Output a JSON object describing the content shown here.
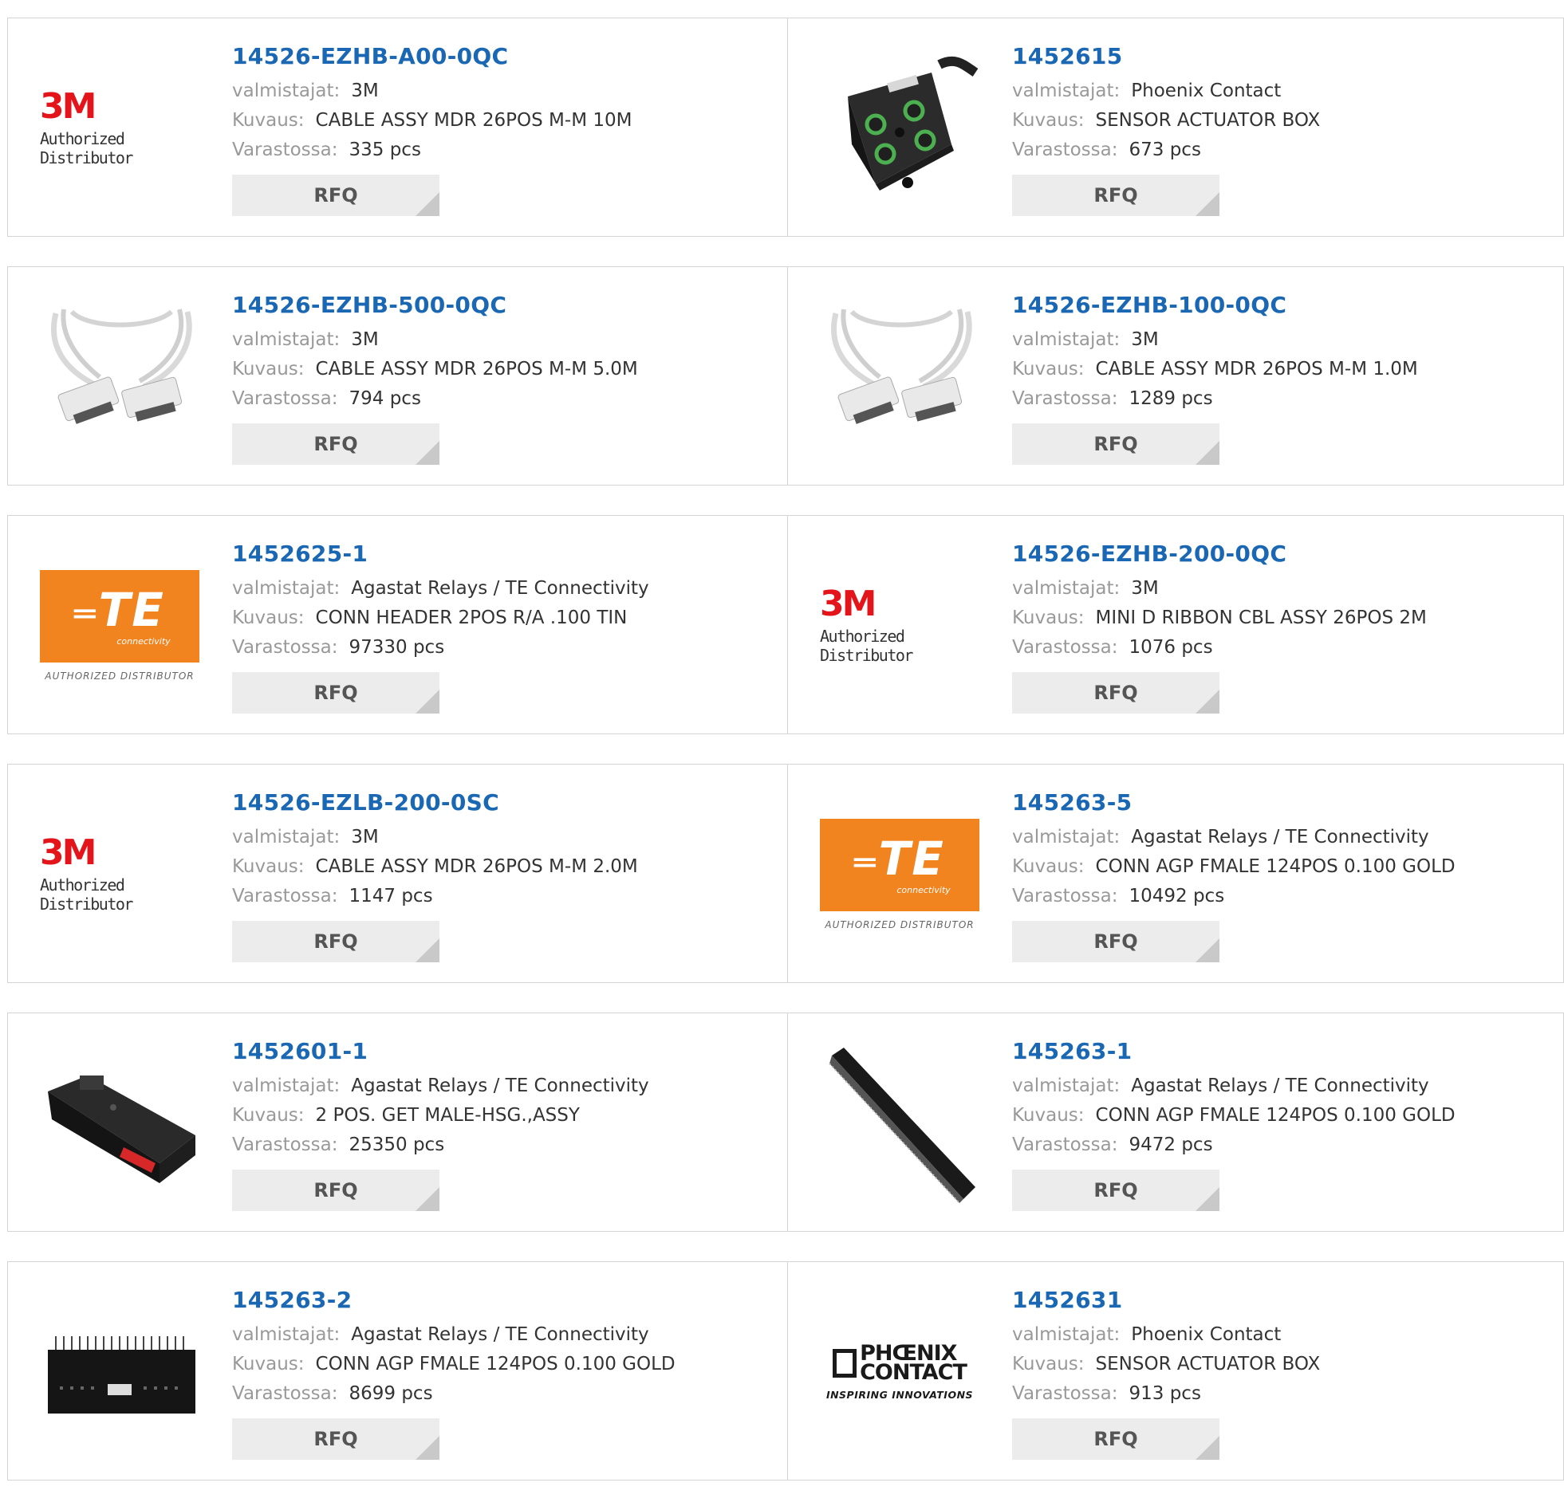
{
  "labels": {
    "manufacturer": "valmistajat:",
    "description": "Kuvaus:",
    "stock": "Varastossa:",
    "rfq": "RFQ"
  },
  "logos": {
    "m3": {
      "brand": "3M",
      "tagline": "Authorized Distributor"
    },
    "te": {
      "brand": "TE",
      "sub": "connectivity",
      "tagline": "AUTHORIZED DISTRIBUTOR"
    },
    "phoenix": {
      "line1": "PHŒNIX",
      "line2": "CONTACT",
      "tagline": "INSPIRING INNOVATIONS"
    }
  },
  "colors": {
    "link": "#1a67b4",
    "te_orange": "#f2841f",
    "m3_red": "#e4141b",
    "button_bg": "#ececec"
  },
  "products": [
    {
      "part": "14526-EZHB-A00-0QC",
      "manufacturer": "3M",
      "description": "CABLE ASSY MDR 26POS M-M 10M",
      "stock": "335 pcs",
      "image": "3m-logo"
    },
    {
      "part": "1452615",
      "manufacturer": "Phoenix Contact",
      "description": "SENSOR ACTUATOR BOX",
      "stock": "673 pcs",
      "image": "sensor-box-photo"
    },
    {
      "part": "14526-EZHB-500-0QC",
      "manufacturer": "3M",
      "description": "CABLE ASSY MDR 26POS M-M 5.0M",
      "stock": "794 pcs",
      "image": "cable-photo"
    },
    {
      "part": "14526-EZHB-100-0QC",
      "manufacturer": "3M",
      "description": "CABLE ASSY MDR 26POS M-M 1.0M",
      "stock": "1289 pcs",
      "image": "cable-photo"
    },
    {
      "part": "1452625-1",
      "manufacturer": "Agastat Relays / TE Connectivity",
      "description": "CONN HEADER 2POS R/A .100 TIN",
      "stock": "97330 pcs",
      "image": "te-logo"
    },
    {
      "part": "14526-EZHB-200-0QC",
      "manufacturer": "3M",
      "description": "MINI D RIBBON CBL ASSY 26POS 2M",
      "stock": "1076 pcs",
      "image": "3m-logo"
    },
    {
      "part": "14526-EZLB-200-0SC",
      "manufacturer": "3M",
      "description": "CABLE ASSY MDR 26POS M-M 2.0M",
      "stock": "1147 pcs",
      "image": "3m-logo"
    },
    {
      "part": "145263-5",
      "manufacturer": "Agastat Relays / TE Connectivity",
      "description": "CONN AGP FMALE 124POS 0.100 GOLD",
      "stock": "10492 pcs",
      "image": "te-logo"
    },
    {
      "part": "1452601-1",
      "manufacturer": "Agastat Relays / TE Connectivity",
      "description": "2 POS. GET MALE-HSG.,ASSY",
      "stock": "25350 pcs",
      "image": "housing-photo"
    },
    {
      "part": "145263-1",
      "manufacturer": "Agastat Relays / TE Connectivity",
      "description": "CONN AGP FMALE 124POS 0.100 GOLD",
      "stock": "9472 pcs",
      "image": "agp-connector-photo"
    },
    {
      "part": "145263-2",
      "manufacturer": "Agastat Relays / TE Connectivity",
      "description": "CONN AGP FMALE 124POS 0.100 GOLD",
      "stock": "8699 pcs",
      "image": "header-photo"
    },
    {
      "part": "1452631",
      "manufacturer": "Phoenix Contact",
      "description": "SENSOR ACTUATOR BOX",
      "stock": "913 pcs",
      "image": "phoenix-logo"
    }
  ]
}
